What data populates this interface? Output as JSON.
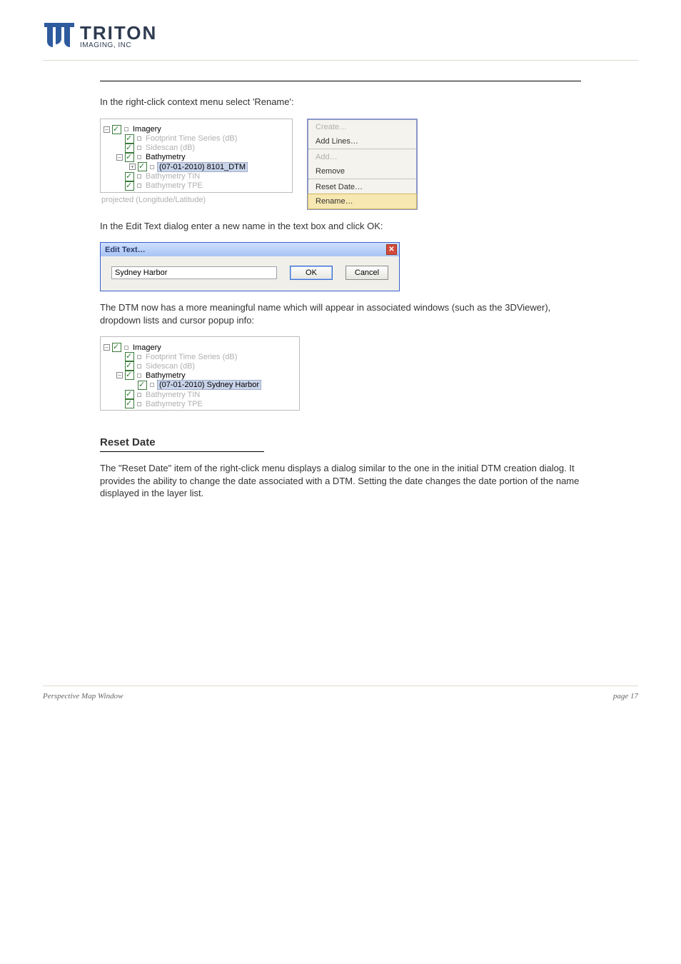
{
  "logo": {
    "line1": "TRITON",
    "line2": "IMAGING, INC"
  },
  "intro": "In the right-click context menu select 'Rename':",
  "tree1": {
    "n_imagery": "Imagery",
    "n_footprint": "Footprint Time Series (dB)",
    "n_sidescan": "Sidescan (dB)",
    "n_bathy": "Bathymetry",
    "n_dtm": "(07-01-2010) 8101_DTM",
    "n_tin": "Bathymetry TIN",
    "n_tpe": "Bathymetry TPE",
    "projected": "projected (Longitude/Latitude)"
  },
  "ctx": {
    "create": "Create…",
    "addlines": "Add Lines…",
    "add": "Add…",
    "remove": "Remove",
    "reset": "Reset Date…",
    "rename": "Rename…"
  },
  "para2": "In the Edit Text dialog enter a new name in the text box and click OK:",
  "dlg": {
    "title": "Edit Text…",
    "value": "Sydney Harbor",
    "ok": "OK",
    "cancel": "Cancel"
  },
  "para3": "The DTM now has a more meaningful name which will appear in associated windows (such as the 3DViewer), dropdown lists and cursor popup info:",
  "tree2": {
    "n_imagery": "Imagery",
    "n_footprint": "Footprint Time Series (dB)",
    "n_sidescan": "Sidescan (dB)",
    "n_bathy": "Bathymetry",
    "n_dtm": "(07-01-2010) Sydney Harbor",
    "n_tin": "Bathymetry TIN",
    "n_tpe": "Bathymetry TPE"
  },
  "subhead": "Reset Date",
  "reset_para": "The \"Reset Date\" item of the right-click menu displays a dialog similar to the one in the initial DTM creation dialog. It provides the ability to change the date associated with a DTM. Setting the date changes the date portion of the name displayed in the layer list.",
  "footer": {
    "left": "Perspective Map Window",
    "right": "page 17"
  }
}
